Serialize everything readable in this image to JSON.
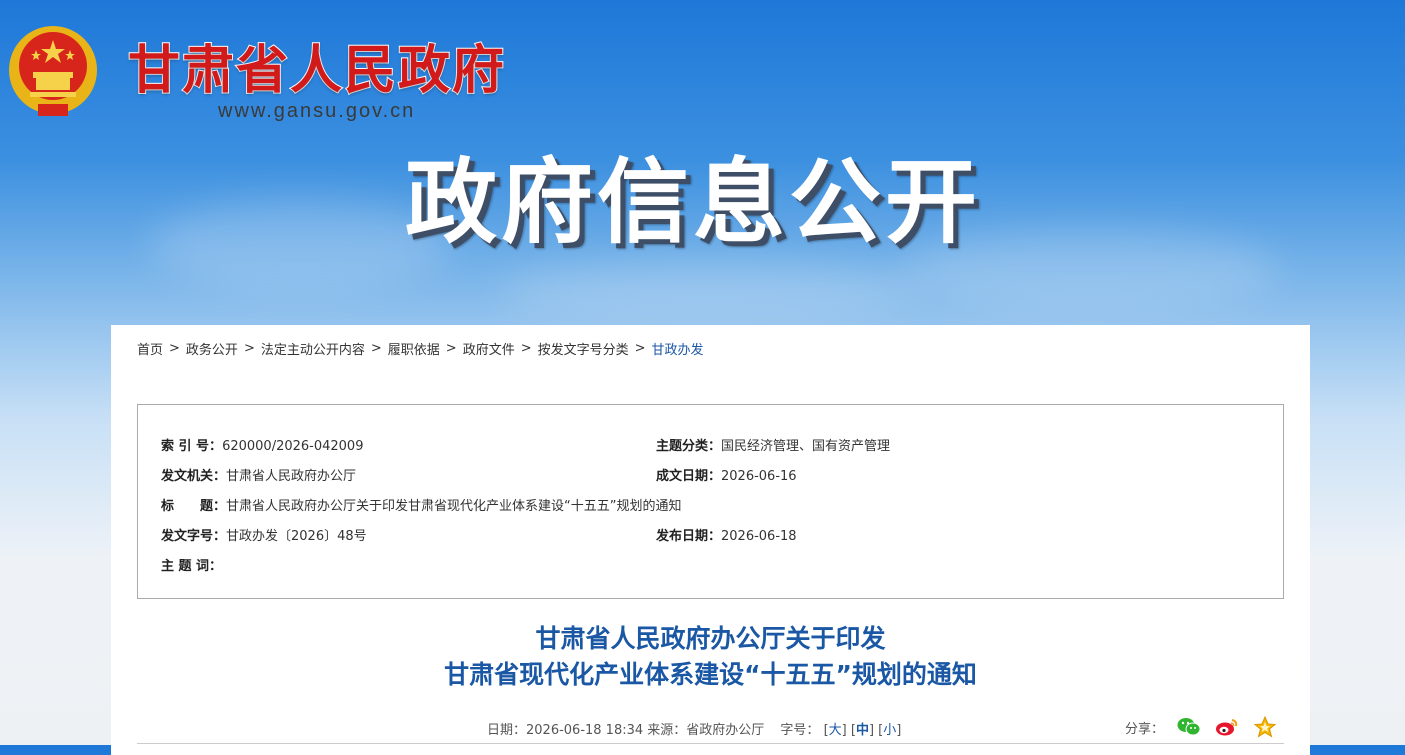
{
  "site": {
    "name": "甘肃省人民政府",
    "url": "www.gansu.gov.cn",
    "banner_title": "政府信息公开"
  },
  "breadcrumb": [
    {
      "label": "首页"
    },
    {
      "label": "政务公开"
    },
    {
      "label": "法定主动公开内容"
    },
    {
      "label": "履职依据"
    },
    {
      "label": "政府文件"
    },
    {
      "label": "按发文字号分类"
    },
    {
      "label": "甘政办发",
      "current": true
    }
  ],
  "breadcrumb_separator": ">",
  "meta": {
    "index_label": "索 引 号：",
    "index_value": "620000/2026-042009",
    "topic_class_label": "主题分类：",
    "topic_class_value": "国民经济管理、国有资产管理",
    "issuer_label": "发文机关：",
    "issuer_value": "甘肃省人民政府办公厅",
    "created_label": "成文日期：",
    "created_value": "2026-06-16",
    "title_label": "标　　题：",
    "title_value": "甘肃省人民政府办公厅关于印发甘肃省现代化产业体系建设“十五五”规划的通知",
    "doc_no_label": "发文字号：",
    "doc_no_value": "甘政办发〔2026〕48号",
    "published_label": "发布日期：",
    "published_value": "2026-06-18",
    "keywords_label": "主 题 词：",
    "keywords_value": ""
  },
  "document": {
    "title_line1": "甘肃省人民政府办公厅关于印发",
    "title_line2": "甘肃省现代化产业体系建设“十五五”规划的通知"
  },
  "info_bar": {
    "date_text": "日期：2026-06-18 18:34 来源：省政府办公厅",
    "font_size_label": "字号：",
    "size_large": "大",
    "size_medium": "中",
    "size_small": "小"
  },
  "share": {
    "label": "分享：",
    "icons": [
      "wechat-icon",
      "weibo-icon",
      "favorite-star-icon"
    ]
  },
  "colors": {
    "accent_blue": "#1a57a4",
    "title_red": "#d21a1a"
  }
}
